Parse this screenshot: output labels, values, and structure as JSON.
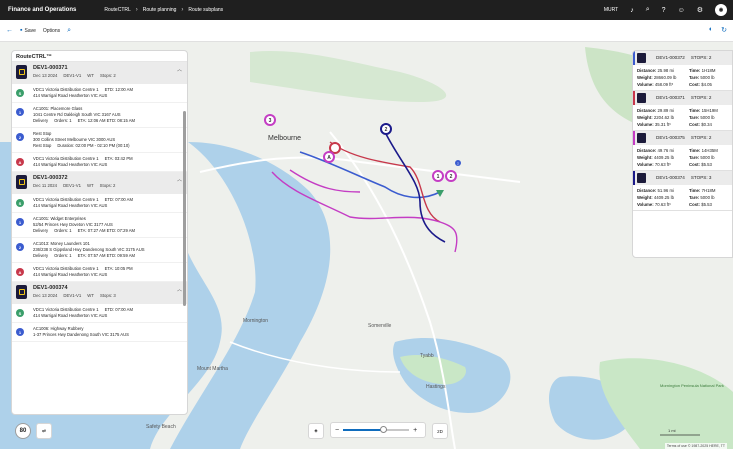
{
  "app": {
    "title": "Finance and Operations",
    "breadcrumbs": [
      "RouteCTRL",
      "Route planning",
      "Route subplans"
    ],
    "company": "MURT"
  },
  "actionbar": {
    "save_label": "Save",
    "options_label": "Options"
  },
  "panel": {
    "title": "RouteCTRL™"
  },
  "routes": [
    {
      "id": "DEV1-000371",
      "date": "Dec 13 2024",
      "device": "DEV1-V1",
      "wh": "WT",
      "stops": "Stops: 2",
      "stop_rows": [
        {
          "marker": "S",
          "color": "g",
          "lines": [
            [
              "VDC1 Victoria Distribution Centre 1",
              "ETD: 12:00 AM"
            ],
            [
              "414 Warrigal Road Heatherton VIC AUS"
            ]
          ]
        },
        {
          "marker": "1",
          "color": "b",
          "lines": [
            [
              "AC1001: Placemore Glass"
            ],
            [
              "1041 Centre Rd Oakleigh South VIC 3167 AUS"
            ],
            [
              "Delivery",
              "Orders: 1",
              "ETA: 12:06 AM ETD: 08:15 AM"
            ]
          ]
        },
        {
          "marker": "2",
          "color": "b",
          "lines": [
            [
              "Rest Stop"
            ],
            [
              "300 Collins Street Melbourne VIC 3000 AUS"
            ],
            [
              "Rest Stop",
              "Duration: 02:00 PM - 02:10 PM (00:10)"
            ]
          ]
        },
        {
          "marker": "A",
          "color": "r",
          "lines": [
            [
              "VDC1 Victoria Distribution Centre 1",
              "ETA: 03:42 PM"
            ],
            [
              "414 Warrigal Road Heatherton VIC AUS"
            ]
          ]
        }
      ]
    },
    {
      "id": "DEV1-000372",
      "date": "Dec 11 2024",
      "device": "DEV1-V1",
      "wh": "WT",
      "stops": "Stops: 2",
      "stop_rows": [
        {
          "marker": "S",
          "color": "g",
          "lines": [
            [
              "VDC1 Victoria Distribution Centre 1",
              "ETD: 07:00 AM"
            ],
            [
              "414 Warrigal Road Heatherton VIC AUS"
            ]
          ]
        },
        {
          "marker": "1",
          "color": "b",
          "lines": [
            [
              "AC1001: Widget Enterprises"
            ],
            [
              "52/54 Princes Hwy Doveton VIC 3177 AUS"
            ],
            [
              "Delivery",
              "Orders: 1",
              "ETA: 07:27 AM ETD: 07:29 AM"
            ]
          ]
        },
        {
          "marker": "2",
          "color": "b",
          "lines": [
            [
              "AC1013: Money Launders 101"
            ],
            [
              "236/238 S Gippsland Hwy Dandenong South VIC 3175 AUS"
            ],
            [
              "Delivery",
              "Orders: 1",
              "ETA: 07:57 AM ETD: 09:59 AM"
            ]
          ]
        },
        {
          "marker": "A",
          "color": "r",
          "lines": [
            [
              "VDC1 Victoria Distribution Centre 1",
              "ETA: 10:05 PM"
            ],
            [
              "414 Warrigal Road Heatherton VIC AUS"
            ]
          ]
        }
      ]
    },
    {
      "id": "DEV1-000374",
      "date": "Dec 13 2024",
      "device": "DEV1-V1",
      "wh": "WT",
      "stops": "Stops: 3",
      "stop_rows": [
        {
          "marker": "S",
          "color": "g",
          "lines": [
            [
              "VDC1 Victoria Distribution Centre 1",
              "ETD: 07:00 AM"
            ],
            [
              "414 Warrigal Road Heatherton VIC AUS"
            ]
          ]
        },
        {
          "marker": "1",
          "color": "b",
          "lines": [
            [
              "AC1006: Highway Rubbery"
            ],
            [
              "1-37 Princes Hwy Dandenong South VIC 3175 AUS"
            ]
          ]
        }
      ]
    }
  ],
  "route_cards": [
    {
      "id": "DEV1-000372",
      "stops": "STOPS: 2",
      "color": "#3b5ccf",
      "rows": [
        [
          "Distance:",
          "25.98 mi",
          "Time:",
          "1H18M"
        ],
        [
          "Weight:",
          "28660.09 lb",
          "Tare:",
          "5000 lb"
        ],
        [
          "Volume:",
          "458.09 ft³",
          "Cost:",
          "$4.05"
        ]
      ]
    },
    {
      "id": "DEV1-000371",
      "stops": "STOPS: 2",
      "color": "#c7384b",
      "rows": [
        [
          "Distance:",
          "29.89 mi",
          "Time:",
          "15H19M"
        ],
        [
          "Weight:",
          "2204.62 lb",
          "Tare:",
          "5000 lb"
        ],
        [
          "Volume:",
          "35.31 ft³",
          "Cost:",
          "$0.34"
        ]
      ]
    },
    {
      "id": "DEV1-000375",
      "stops": "STOPS: 2",
      "color": "#c43dc4",
      "rows": [
        [
          "Distance:",
          "49.76 mi",
          "Time:",
          "14H35M"
        ],
        [
          "Weight:",
          "4409.25 lb",
          "Tare:",
          "5000 lb"
        ],
        [
          "Volume:",
          "70.63 ft³",
          "Cost:",
          "$5.53"
        ]
      ]
    },
    {
      "id": "DEV1-000374",
      "stops": "STOPS: 3",
      "color": "#1b1a8a",
      "rows": [
        [
          "Distance:",
          "51.96 mi",
          "Time:",
          "7H18M"
        ],
        [
          "Weight:",
          "4409.25 lb",
          "Tare:",
          "5000 lb"
        ],
        [
          "Volume:",
          "70.63 ft³",
          "Cost:",
          "$5.53"
        ]
      ]
    }
  ],
  "map": {
    "labels": [
      "Melbourne",
      "Mornington",
      "Somerville",
      "Tyabb",
      "Mount Martha",
      "Hastings",
      "Safety Beach",
      "Mornington Peninsula National Park"
    ],
    "credit": "Terms of use  © 1987-2025 HERE, TT",
    "scale": "1 mi",
    "speed_label": "80",
    "pins": [
      "1",
      "2",
      "3",
      "A",
      "1",
      "2",
      "2"
    ],
    "zoom_level": 0.6
  }
}
